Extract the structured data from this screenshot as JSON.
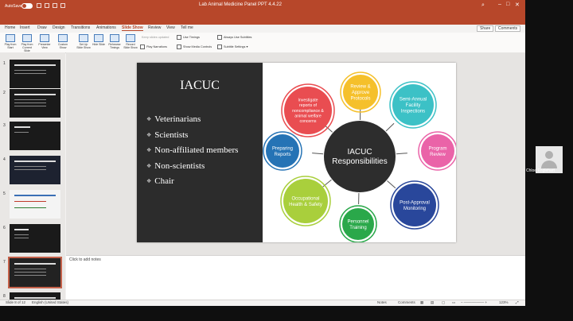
{
  "titlebar": {
    "autosave": "AutoSave",
    "toggle_state": "OFF",
    "doc_title": "Lab Animal Medicine Panel PPT 4.4.22",
    "search_icon": "search-icon",
    "window_controls": [
      "–",
      "□",
      "✕"
    ]
  },
  "tabs": [
    "Home",
    "Insert",
    "Draw",
    "Design",
    "Transitions",
    "Animations",
    "Slide Show",
    "Review",
    "View",
    "Tell me"
  ],
  "active_tab": "Slide Show",
  "share_label": "Share",
  "comments_label": "Comments",
  "ribbon": {
    "buttons": [
      "Play from Start",
      "Play from Current Slide",
      "Presenter View",
      "Custom Show",
      "Set Up Slide Show",
      "Hide Slide",
      "Rehearse Timings",
      "Record Slide Show"
    ],
    "options": [
      "Keep slides updated",
      "Use Timings",
      "Play Narrations",
      "Show Media Controls",
      "Always Use Subtitles",
      "Subtitle Settings"
    ]
  },
  "thumbnails": {
    "numbers": [
      "1",
      "2",
      "3",
      "4",
      "5",
      "6",
      "7",
      "8"
    ],
    "selected": "7"
  },
  "slide": {
    "title": "IACUC",
    "bullets": [
      "Veterinarians",
      "Scientists",
      "Non-affiliated members",
      "Non-scientists",
      "Chair"
    ],
    "diagram": {
      "center_lines": [
        "IACUC",
        "Responsibilities"
      ],
      "nodes": [
        {
          "lines": [
            "Review &",
            "Approve",
            "Protocols"
          ],
          "color": "#f5c02b"
        },
        {
          "lines": [
            "Semi-Annual",
            "Facility",
            "Inspections"
          ],
          "color": "#3cc1c6"
        },
        {
          "lines": [
            "Program",
            "Review"
          ],
          "color": "#ea63a8"
        },
        {
          "lines": [
            "Post-Approval",
            "Monitoring"
          ],
          "color": "#29479b"
        },
        {
          "lines": [
            "Personnel",
            "Training"
          ],
          "color": "#2aa84a"
        },
        {
          "lines": [
            "Occupational",
            "Health & Safety"
          ],
          "color": "#a9cf3c"
        },
        {
          "lines": [
            "Preparing",
            "Reports"
          ],
          "color": "#2573b5"
        },
        {
          "lines": [
            "Investigate",
            "reports of",
            "noncompliance &",
            "animal welfare",
            "concerns"
          ],
          "color": "#e94d51"
        }
      ]
    }
  },
  "notes_placeholder": "Click to add notes",
  "status": {
    "slide_info": "Slide 8 of 12",
    "language": "English (United States)",
    "notes_label": "Notes",
    "comments_label": "Comments",
    "zoom": "123%"
  },
  "participant": {
    "name": "Chloe Englehart"
  }
}
